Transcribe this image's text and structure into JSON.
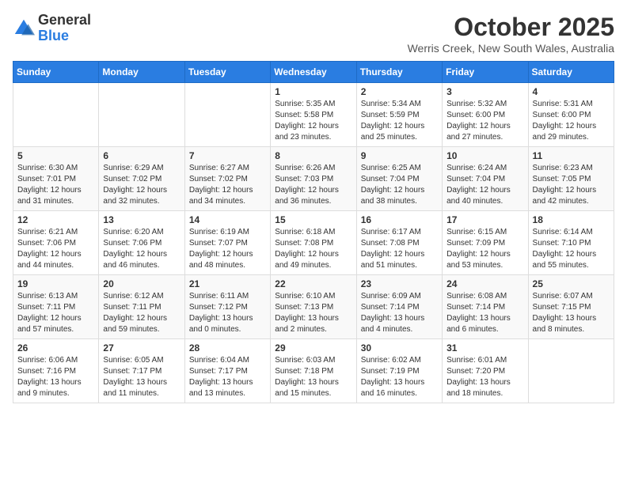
{
  "logo": {
    "line1": "General",
    "line2": "Blue"
  },
  "title": "October 2025",
  "subtitle": "Werris Creek, New South Wales, Australia",
  "weekdays": [
    "Sunday",
    "Monday",
    "Tuesday",
    "Wednesday",
    "Thursday",
    "Friday",
    "Saturday"
  ],
  "weeks": [
    [
      {
        "day": "",
        "info": ""
      },
      {
        "day": "",
        "info": ""
      },
      {
        "day": "",
        "info": ""
      },
      {
        "day": "1",
        "info": "Sunrise: 5:35 AM\nSunset: 5:58 PM\nDaylight: 12 hours\nand 23 minutes."
      },
      {
        "day": "2",
        "info": "Sunrise: 5:34 AM\nSunset: 5:59 PM\nDaylight: 12 hours\nand 25 minutes."
      },
      {
        "day": "3",
        "info": "Sunrise: 5:32 AM\nSunset: 6:00 PM\nDaylight: 12 hours\nand 27 minutes."
      },
      {
        "day": "4",
        "info": "Sunrise: 5:31 AM\nSunset: 6:00 PM\nDaylight: 12 hours\nand 29 minutes."
      }
    ],
    [
      {
        "day": "5",
        "info": "Sunrise: 6:30 AM\nSunset: 7:01 PM\nDaylight: 12 hours\nand 31 minutes."
      },
      {
        "day": "6",
        "info": "Sunrise: 6:29 AM\nSunset: 7:02 PM\nDaylight: 12 hours\nand 32 minutes."
      },
      {
        "day": "7",
        "info": "Sunrise: 6:27 AM\nSunset: 7:02 PM\nDaylight: 12 hours\nand 34 minutes."
      },
      {
        "day": "8",
        "info": "Sunrise: 6:26 AM\nSunset: 7:03 PM\nDaylight: 12 hours\nand 36 minutes."
      },
      {
        "day": "9",
        "info": "Sunrise: 6:25 AM\nSunset: 7:04 PM\nDaylight: 12 hours\nand 38 minutes."
      },
      {
        "day": "10",
        "info": "Sunrise: 6:24 AM\nSunset: 7:04 PM\nDaylight: 12 hours\nand 40 minutes."
      },
      {
        "day": "11",
        "info": "Sunrise: 6:23 AM\nSunset: 7:05 PM\nDaylight: 12 hours\nand 42 minutes."
      }
    ],
    [
      {
        "day": "12",
        "info": "Sunrise: 6:21 AM\nSunset: 7:06 PM\nDaylight: 12 hours\nand 44 minutes."
      },
      {
        "day": "13",
        "info": "Sunrise: 6:20 AM\nSunset: 7:06 PM\nDaylight: 12 hours\nand 46 minutes."
      },
      {
        "day": "14",
        "info": "Sunrise: 6:19 AM\nSunset: 7:07 PM\nDaylight: 12 hours\nand 48 minutes."
      },
      {
        "day": "15",
        "info": "Sunrise: 6:18 AM\nSunset: 7:08 PM\nDaylight: 12 hours\nand 49 minutes."
      },
      {
        "day": "16",
        "info": "Sunrise: 6:17 AM\nSunset: 7:08 PM\nDaylight: 12 hours\nand 51 minutes."
      },
      {
        "day": "17",
        "info": "Sunrise: 6:15 AM\nSunset: 7:09 PM\nDaylight: 12 hours\nand 53 minutes."
      },
      {
        "day": "18",
        "info": "Sunrise: 6:14 AM\nSunset: 7:10 PM\nDaylight: 12 hours\nand 55 minutes."
      }
    ],
    [
      {
        "day": "19",
        "info": "Sunrise: 6:13 AM\nSunset: 7:11 PM\nDaylight: 12 hours\nand 57 minutes."
      },
      {
        "day": "20",
        "info": "Sunrise: 6:12 AM\nSunset: 7:11 PM\nDaylight: 12 hours\nand 59 minutes."
      },
      {
        "day": "21",
        "info": "Sunrise: 6:11 AM\nSunset: 7:12 PM\nDaylight: 13 hours\nand 0 minutes."
      },
      {
        "day": "22",
        "info": "Sunrise: 6:10 AM\nSunset: 7:13 PM\nDaylight: 13 hours\nand 2 minutes."
      },
      {
        "day": "23",
        "info": "Sunrise: 6:09 AM\nSunset: 7:14 PM\nDaylight: 13 hours\nand 4 minutes."
      },
      {
        "day": "24",
        "info": "Sunrise: 6:08 AM\nSunset: 7:14 PM\nDaylight: 13 hours\nand 6 minutes."
      },
      {
        "day": "25",
        "info": "Sunrise: 6:07 AM\nSunset: 7:15 PM\nDaylight: 13 hours\nand 8 minutes."
      }
    ],
    [
      {
        "day": "26",
        "info": "Sunrise: 6:06 AM\nSunset: 7:16 PM\nDaylight: 13 hours\nand 9 minutes."
      },
      {
        "day": "27",
        "info": "Sunrise: 6:05 AM\nSunset: 7:17 PM\nDaylight: 13 hours\nand 11 minutes."
      },
      {
        "day": "28",
        "info": "Sunrise: 6:04 AM\nSunset: 7:17 PM\nDaylight: 13 hours\nand 13 minutes."
      },
      {
        "day": "29",
        "info": "Sunrise: 6:03 AM\nSunset: 7:18 PM\nDaylight: 13 hours\nand 15 minutes."
      },
      {
        "day": "30",
        "info": "Sunrise: 6:02 AM\nSunset: 7:19 PM\nDaylight: 13 hours\nand 16 minutes."
      },
      {
        "day": "31",
        "info": "Sunrise: 6:01 AM\nSunset: 7:20 PM\nDaylight: 13 hours\nand 18 minutes."
      },
      {
        "day": "",
        "info": ""
      }
    ]
  ]
}
